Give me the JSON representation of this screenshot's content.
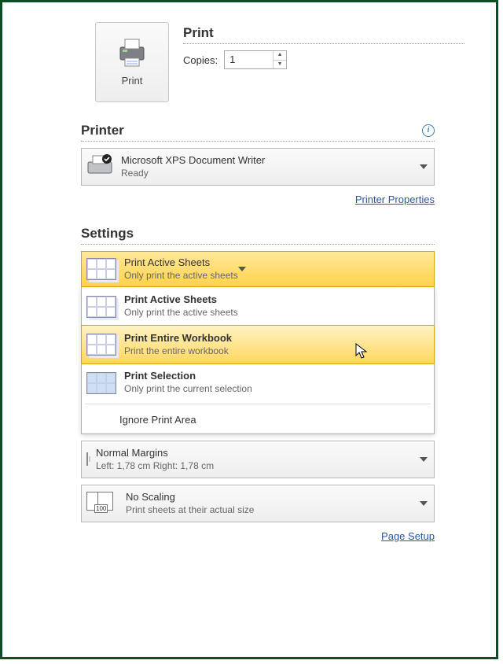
{
  "print_button_label": "Print",
  "print_heading": "Print",
  "copies_label": "Copies:",
  "copies_value": "1",
  "printer_heading": "Printer",
  "printer": {
    "name": "Microsoft XPS Document Writer",
    "status": "Ready"
  },
  "printer_properties_link": "Printer Properties",
  "settings_heading": "Settings",
  "selected_option": {
    "title": "Print Active Sheets",
    "sub": "Only print the active sheets"
  },
  "options": [
    {
      "title": "Print Active Sheets",
      "sub": "Only print the active sheets"
    },
    {
      "title": "Print Entire Workbook",
      "sub": "Print the entire workbook"
    },
    {
      "title": "Print Selection",
      "sub": "Only print the current selection"
    }
  ],
  "ignore_label": "Ignore Print Area",
  "margins_option": {
    "title": "Normal Margins",
    "sub": "Left: 1,78 cm   Right: 1,78 cm"
  },
  "scaling_option": {
    "title": "No Scaling",
    "sub": "Print sheets at their actual size"
  },
  "scaling_tag": "100",
  "page_setup_link": "Page Setup"
}
